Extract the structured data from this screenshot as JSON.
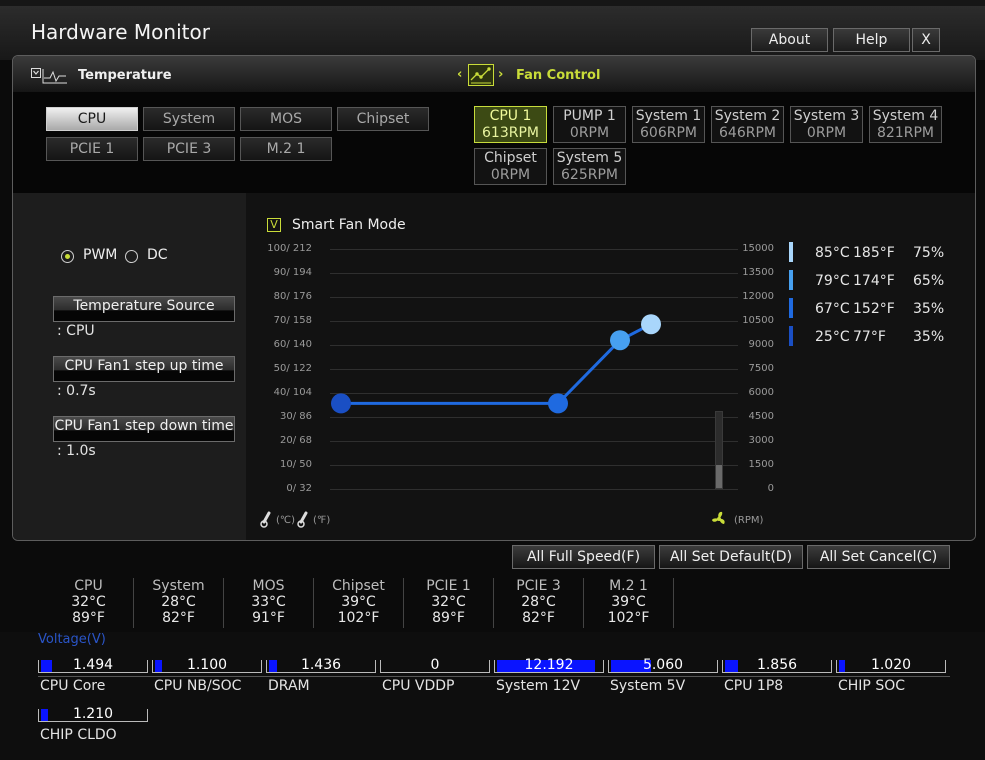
{
  "window": {
    "title": "Hardware Monitor",
    "buttons": [
      "About",
      "Help",
      "X"
    ]
  },
  "tabs": {
    "temperature": "Temperature",
    "fan_control": "Fan Control",
    "left_arrow": "‹",
    "right_arrow": "›"
  },
  "sensors": [
    "CPU",
    "System",
    "MOS",
    "Chipset",
    "PCIE 1",
    "PCIE 3",
    "M.2 1"
  ],
  "selected_sensor": "CPU",
  "fans": [
    {
      "name": "CPU 1",
      "rpm": "613RPM"
    },
    {
      "name": "PUMP 1",
      "rpm": "0RPM"
    },
    {
      "name": "System 1",
      "rpm": "606RPM"
    },
    {
      "name": "System 2",
      "rpm": "646RPM"
    },
    {
      "name": "System 3",
      "rpm": "0RPM"
    },
    {
      "name": "System 4",
      "rpm": "821RPM"
    },
    {
      "name": "Chipset",
      "rpm": "0RPM"
    },
    {
      "name": "System 5",
      "rpm": "625RPM"
    }
  ],
  "selected_fan": "CPU 1",
  "mode": {
    "pwm": "PWM",
    "dc": "DC",
    "selected": "PWM"
  },
  "settings": {
    "temp_source_label": "Temperature Source",
    "temp_source_value": ": CPU",
    "step_up_label": "CPU Fan1 step up time",
    "step_up_value": ": 0.7s",
    "step_down_label": "CPU Fan1 step down time",
    "step_down_value": ": 1.0s"
  },
  "smart_fan": {
    "label": "Smart Fan Mode",
    "checked": true,
    "check_glyph": "V"
  },
  "chart_data": {
    "type": "line",
    "left_ticks": [
      "100/ 212",
      "90/ 194",
      "80/ 176",
      "70/ 158",
      "60/ 140",
      "50/ 122",
      "40/ 104",
      "30/  86",
      "20/  68",
      "10/  50",
      "0/  32"
    ],
    "right_ticks": [
      "15000",
      "13500",
      "12000",
      "10500",
      "9000",
      "7500",
      "6000",
      "4500",
      "3000",
      "1500",
      "0"
    ],
    "x_unit_c": "(℃)",
    "x_unit_f": "(℉)",
    "y_unit": "(RPM)",
    "points": [
      {
        "temp_c": 25,
        "rpm": 5350,
        "color": "#1a4fc4"
      },
      {
        "temp_c": 67,
        "rpm": 5350,
        "color": "#1f6ae0"
      },
      {
        "temp_c": 79,
        "rpm": 9300,
        "color": "#47a0f0"
      },
      {
        "temp_c": 85,
        "rpm": 10300,
        "color": "#a9d6fb"
      }
    ],
    "current_level_fraction": 0.3
  },
  "points_table": [
    {
      "c": "85°C",
      "f": "185°F",
      "pct": "75%",
      "color": "#a9d6fb"
    },
    {
      "c": "79°C",
      "f": "174°F",
      "pct": "65%",
      "color": "#47a0f0"
    },
    {
      "c": "67°C",
      "f": "152°F",
      "pct": "35%",
      "color": "#1f6ae0"
    },
    {
      "c": "25°C",
      "f": "77°F",
      "pct": "35%",
      "color": "#1a4fc4"
    }
  ],
  "bottom_buttons": [
    "All Full Speed(F)",
    "All Set Default(D)",
    "All Set Cancel(C)"
  ],
  "temps": [
    {
      "name": "CPU",
      "c": "32°C",
      "f": "89°F"
    },
    {
      "name": "System",
      "c": "28°C",
      "f": "82°F"
    },
    {
      "name": "MOS",
      "c": "33°C",
      "f": "91°F"
    },
    {
      "name": "Chipset",
      "c": "39°C",
      "f": "102°F"
    },
    {
      "name": "PCIE 1",
      "c": "32°C",
      "f": "89°F"
    },
    {
      "name": "PCIE 3",
      "c": "28°C",
      "f": "82°F"
    },
    {
      "name": "M.2 1",
      "c": "39°C",
      "f": "102°F"
    }
  ],
  "voltage": {
    "header": "Voltage(V)",
    "items": [
      {
        "name": "CPU Core",
        "value": "1.494",
        "fill": 0.1
      },
      {
        "name": "CPU NB/SOC",
        "value": "1.100",
        "fill": 0.07
      },
      {
        "name": "DRAM",
        "value": "1.436",
        "fill": 0.08
      },
      {
        "name": "CPU VDDP",
        "value": "0",
        "fill": 0
      },
      {
        "name": "System 12V",
        "value": "12.192",
        "fill": 0.92
      },
      {
        "name": "System 5V",
        "value": "5.060",
        "fill": 0.38
      },
      {
        "name": "CPU 1P8",
        "value": "1.856",
        "fill": 0.12
      },
      {
        "name": "CHIP SOC",
        "value": "1.020",
        "fill": 0.06
      },
      {
        "name": "CHIP CLDO",
        "value": "1.210",
        "fill": 0.07
      }
    ]
  },
  "colors": {
    "accent": "#c9dc39",
    "voltage_bar": "#0a14ff",
    "voltage_header": "#2a55c8"
  }
}
